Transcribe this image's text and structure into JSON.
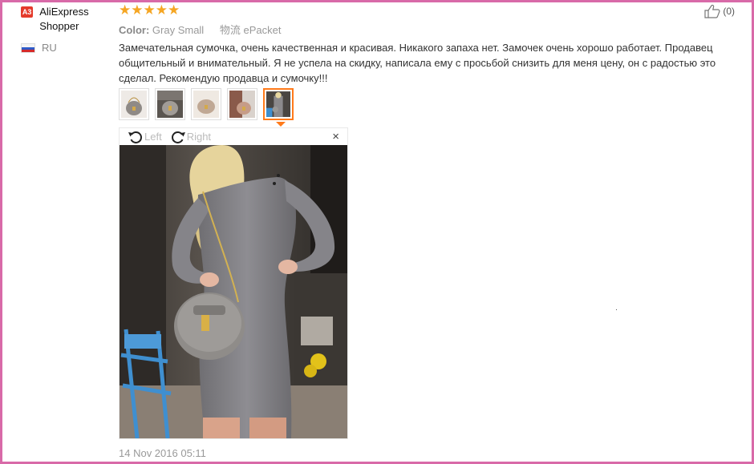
{
  "reviewer": {
    "avatar_text": "A3",
    "name": "AliExpress Shopper",
    "country": "RU"
  },
  "rating": {
    "stars": 5,
    "max": 5,
    "glyphs": "★★★★★"
  },
  "likes": {
    "count_text": "(0)",
    "icon": "thumbs-up-icon"
  },
  "meta": {
    "color_label": "Color:",
    "color_value": "Gray Small",
    "shipping_label": "物流",
    "shipping_value": "ePacket"
  },
  "review_text": "Замечательная сумочка, очень качественная и красивая. Никакого запаха нет. Замочек очень хорошо работает. Продавец общительный и внимательный. Я не успела на скидку, написала ему с просьбой снизить для меня цену, он с радостью это сделал. Рекомендую продавца и сумочку!!!",
  "thumbnails": [
    {
      "label": "bag-photo-1",
      "active": false
    },
    {
      "label": "bag-photo-2",
      "active": false
    },
    {
      "label": "bag-photo-3",
      "active": false
    },
    {
      "label": "bag-photo-4",
      "active": false
    },
    {
      "label": "bag-photo-5",
      "active": true
    }
  ],
  "viewer": {
    "rotate_left": "Left",
    "rotate_right": "Right",
    "close_glyph": "×"
  },
  "date": "14 Nov 2016 05:11",
  "colors": {
    "frame": "#d86aa8",
    "stars": "#f5a623",
    "active_thumb": "#ff7a1a",
    "avatar_bg": "#e43b2c"
  }
}
